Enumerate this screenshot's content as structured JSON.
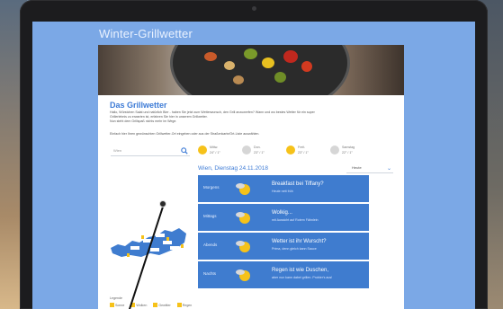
{
  "app": {
    "title": "Winter-Grillwetter"
  },
  "content": {
    "heading": "Das Grillwetter",
    "intro_lines": [
      "Hallo, Würstchen Salat und natürlich Bier - haben Sie jetzt zum Wetterwunsch, den Grill anzuwerfen? Wann und wo bestes Wetter für ein super",
      "Grillerlebnis zu erwarten ist, erfahren Sie hier in unserem Grillwetter.",
      "Nun steht dem Grillspaß nichts mehr im Wege."
    ],
    "instruction": "Einfach hier Ihren gewünschten Grillwetter-Ort eingeben oder aus der Straßenkarte/Ort-Liste auswählen."
  },
  "search": {
    "placeholder": "Wien"
  },
  "top_forecast": [
    {
      "day": "Mittw.",
      "temp": "24° / 1°",
      "icon": "sun-icon"
    },
    {
      "day": "Don.",
      "temp": "23° / 1°",
      "icon": "sun-cloud-icon"
    },
    {
      "day": "Freit.",
      "temp": "23° / 1°",
      "icon": "sun-icon"
    },
    {
      "day": "Samstag",
      "temp": "22° / 1°",
      "icon": "sun-cloud-icon"
    }
  ],
  "forecast": {
    "date_heading": "Wien, Dienstag 24.11.2018",
    "day_select_label": "Heute",
    "rows": [
      {
        "label": "Morgens",
        "title": "Breakfast bei Tiffany?",
        "sub": "Heute nett früh"
      },
      {
        "label": "Mittags",
        "title": "Wolkig...",
        "sub": "mit Aussicht auf Rotem Fähnlein"
      },
      {
        "label": "Abends",
        "title": "Wetter ist ihr Wurscht?",
        "sub": "Prima, denn gleich kann Sauce"
      },
      {
        "label": "Nachts",
        "title": "Regen ist wie Duschen,",
        "sub": "aber nun kann dabei grillen. Probier's aus!"
      }
    ]
  },
  "legend": {
    "title": "Legende",
    "items": [
      "Sonne",
      "Wolken",
      "Gewitter",
      "Regen"
    ]
  },
  "colors": {
    "screen_bg": "#7ba8e6",
    "row_bg": "#3f7ccf",
    "accent": "#3d7bd6",
    "sun": "#f6c21a"
  }
}
